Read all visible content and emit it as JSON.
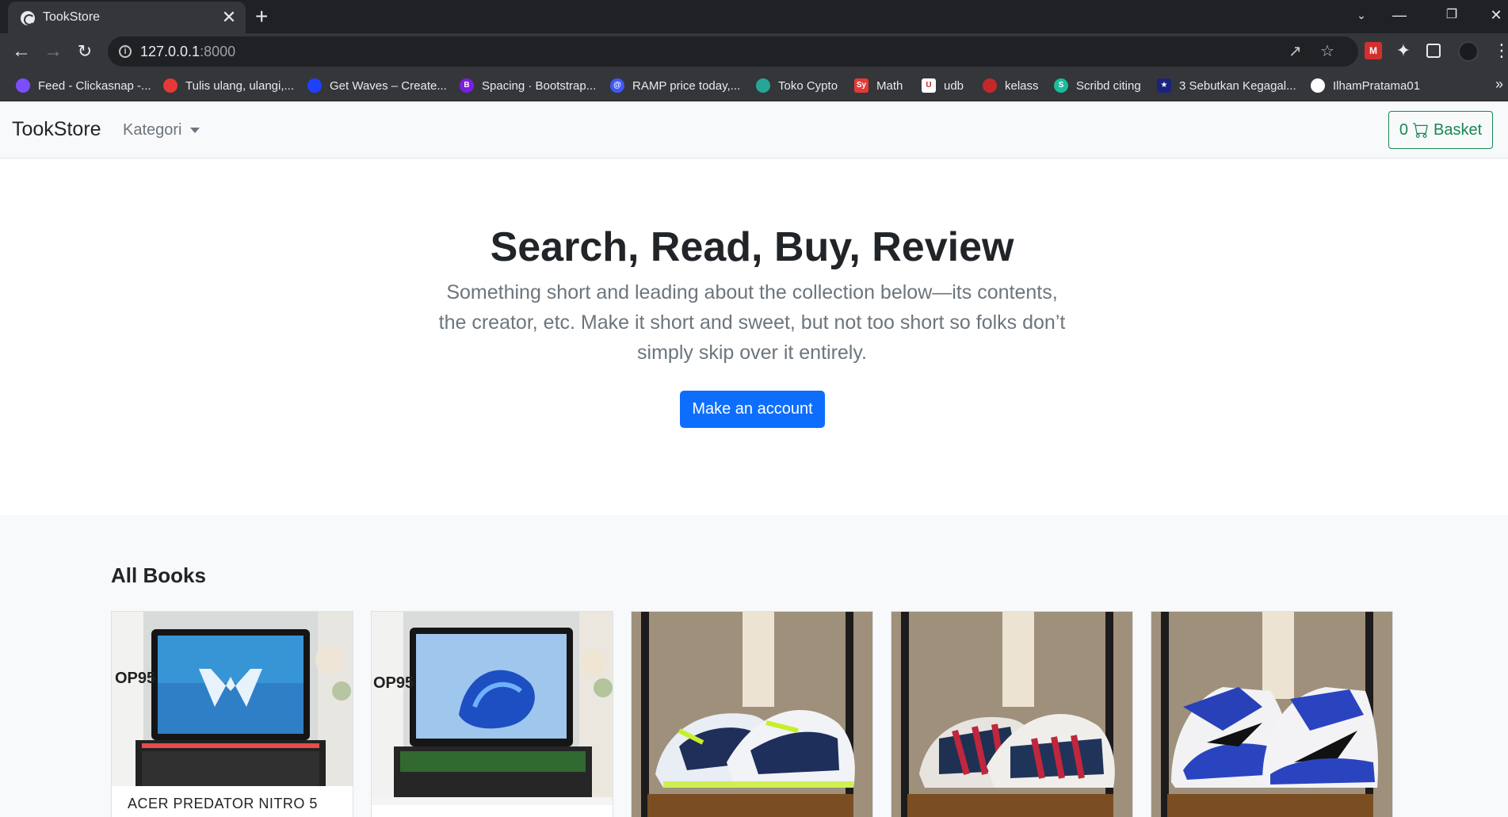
{
  "browser": {
    "tab_title": "TookStore",
    "tab_close": "✕",
    "new_tab": "+",
    "url_host": "127.0.0.1",
    "url_port": ":8000",
    "bookmarks": [
      {
        "label": "Feed - Clickasnap -...",
        "color": "#7c4dff"
      },
      {
        "label": "Tulis ulang, ulangi,...",
        "color": "#e53935"
      },
      {
        "label": "Get Waves – Create...",
        "color": "#1e40ff"
      },
      {
        "label": "Spacing · Bootstrap...",
        "color": "#7b1fe0"
      },
      {
        "label": "RAMP price today,...",
        "color": "#3d5afe"
      },
      {
        "label": "Toko Cypto",
        "color": "#26a69a"
      },
      {
        "label": "Math",
        "color": "#e53935"
      },
      {
        "label": "udb",
        "color": "#ffffff"
      },
      {
        "label": "kelass",
        "color": "#c62828"
      },
      {
        "label": "Scribd citing",
        "color": "#1abc9c"
      },
      {
        "label": "3 Sebutkan Kegagal...",
        "color": "#1a237e"
      },
      {
        "label": "IlhamPratama01",
        "color": "#ffffff"
      }
    ]
  },
  "navbar": {
    "brand": "TookStore",
    "category_label": "Kategori",
    "basket_count": "0",
    "basket_label": "Basket",
    "accent": "#198754"
  },
  "hero": {
    "title": "Search, Read, Buy, Review",
    "lead": "Something short and leading about the collection below—its contents, the creator, etc. Make it short and sweet, but not too short so folks don’t simply skip over it entirely.",
    "button_label": "Make an account",
    "button_color": "#0d6efd"
  },
  "albums": {
    "title": "All Books",
    "cards": [
      {
        "title": "ACER PREDATOR NITRO 5",
        "image": "laptop-acer-predator"
      },
      {
        "title": "",
        "image": "laptop-hp-pavilion"
      },
      {
        "title": "",
        "image": "sneaker-nike-zoom"
      },
      {
        "title": "",
        "image": "sneaker-adidas-zx"
      },
      {
        "title": "",
        "image": "sneaker-jordan-1"
      }
    ]
  }
}
